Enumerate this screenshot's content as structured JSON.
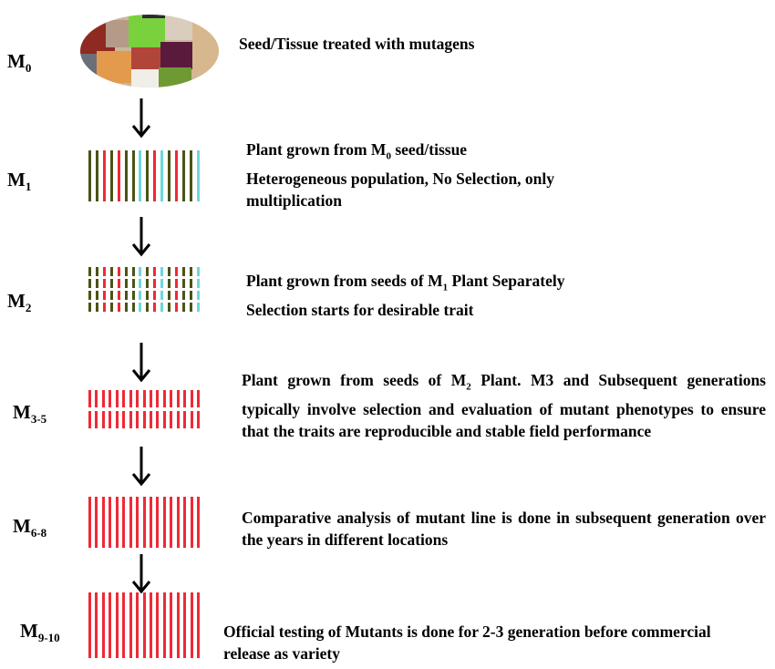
{
  "colors": {
    "green": "#4b5315",
    "red": "#ee2a35",
    "cyan": "#6fd6dc",
    "text": "#000000"
  },
  "m1_pattern": [
    "g",
    "g",
    "r",
    "g",
    "r",
    "g",
    "g",
    "c",
    "g",
    "r",
    "c",
    "g",
    "r",
    "g",
    "g",
    "c"
  ],
  "stages": [
    {
      "label": "M",
      "sub": "0",
      "lines": [
        "Seed/Tissue treated with mutagens"
      ]
    },
    {
      "label": "M",
      "sub": "1",
      "lines": [
        "Plant grown from M",
        "0",
        " seed/tissue",
        "Heterogeneous population, No Selection, only multiplication"
      ]
    },
    {
      "label": "M",
      "sub": "2",
      "lines": [
        "Plant grown from seeds of M",
        "1",
        " Plant Separately",
        "Selection starts for desirable trait"
      ]
    },
    {
      "label": "M",
      "sub": "3-5",
      "lines": [
        "Plant grown from seeds of M",
        "2",
        " Plant. M3 and Subsequent generations typically involve selection and evaluation of mutant phenotypes to ensure that the traits are reproducible and stable field performance"
      ]
    },
    {
      "label": "M",
      "sub": "6-8",
      "lines": [
        "Comparative analysis of mutant line is done in subsequent generation over the years in different locations"
      ]
    },
    {
      "label": "M",
      "sub": "9-10",
      "lines": [
        "Official testing of Mutants is done for 2-3 generation before commercial release as variety"
      ]
    }
  ]
}
